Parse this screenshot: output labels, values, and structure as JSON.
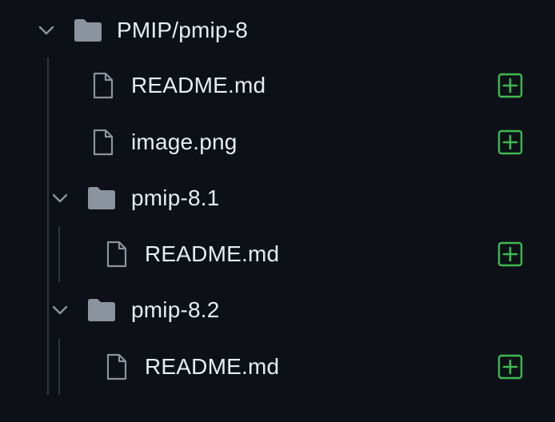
{
  "tree": {
    "root": {
      "name": "PMIP/pmip-8"
    },
    "files": [
      {
        "name": "README.md"
      },
      {
        "name": "image.png"
      }
    ],
    "folders": [
      {
        "name": "pmip-8.1",
        "files": [
          {
            "name": "README.md"
          }
        ]
      },
      {
        "name": "pmip-8.2",
        "files": [
          {
            "name": "README.md"
          }
        ]
      }
    ]
  },
  "colors": {
    "background": "#0d1117",
    "text": "#e6edf3",
    "icon": "#8b949e",
    "folder": "#8b949e",
    "added": "#3fb950",
    "guide": "#30363d"
  },
  "icons": {
    "expand": "chevron-down-icon",
    "folder": "folder-icon",
    "file": "file-icon",
    "added": "diff-added-icon"
  }
}
